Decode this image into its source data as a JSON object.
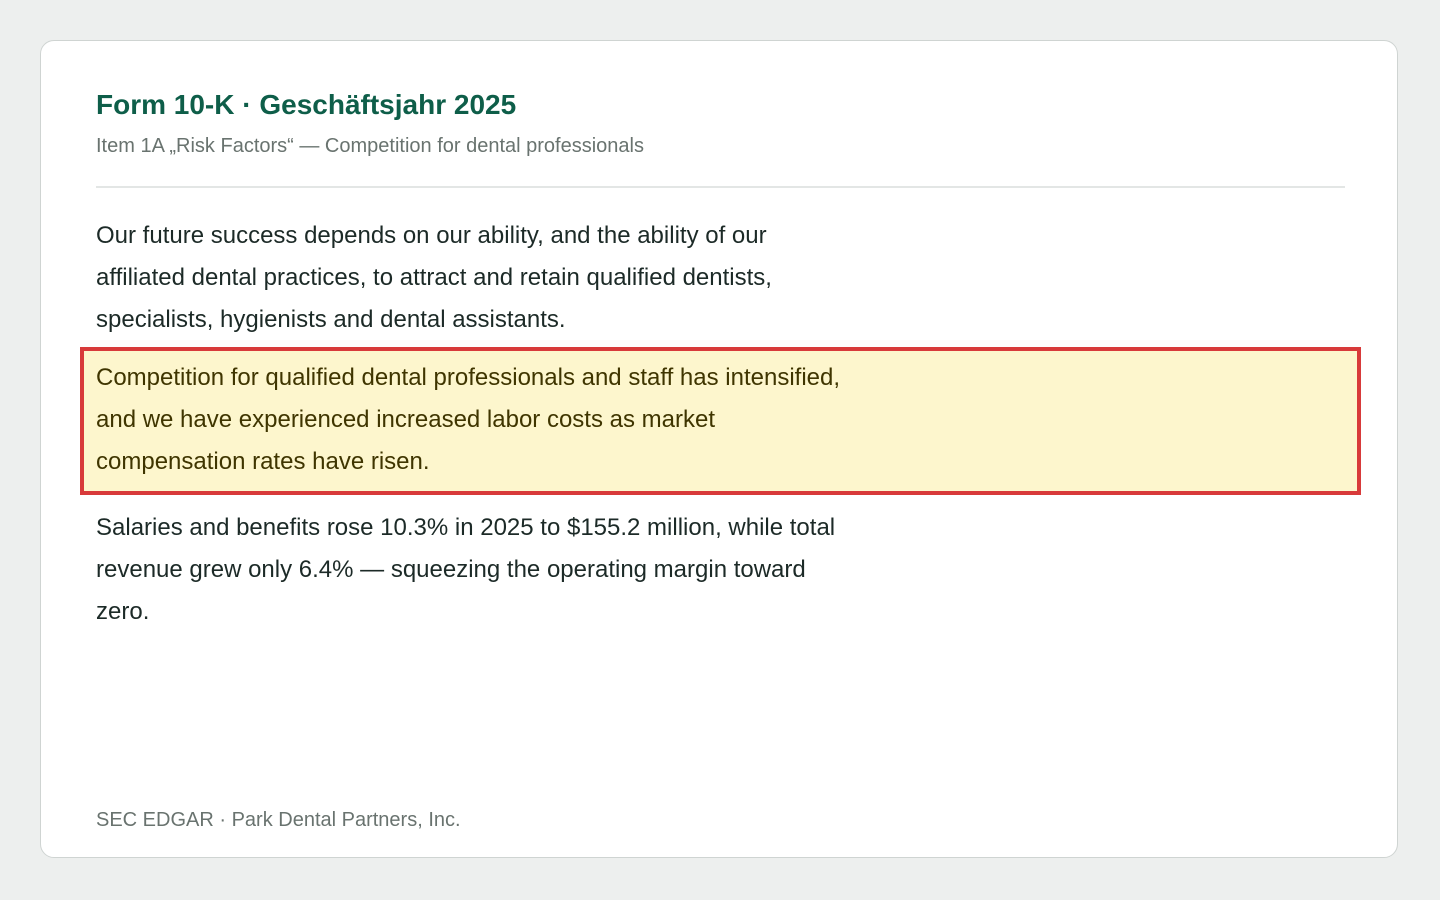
{
  "header": {
    "title": "Form 10-K · Geschäftsjahr 2025",
    "subtitle": "Item 1A „Risk Factors“ — Competition for dental professionals"
  },
  "body": {
    "paragraphs": [
      "Our future success depends on our ability, and the ability of our affiliated dental practices, to attract and retain qualified dentists, specialists, hygienists and dental assistants.",
      "Competition for qualified dental professionals and staff has intensified, and we have experienced increased labor costs as market compensation rates have risen.",
      "Salaries and benefits rose 10.3% in 2025 to $155.2 million, while total revenue grew only 6.4% — squeezing the operating margin toward zero."
    ]
  },
  "footer": {
    "source": "SEC EDGAR · Park Dental Partners, Inc."
  },
  "colors": {
    "title": "#0e5e49",
    "highlight_background": "#fdf6cd",
    "highlight_border": "#d83a3a"
  }
}
